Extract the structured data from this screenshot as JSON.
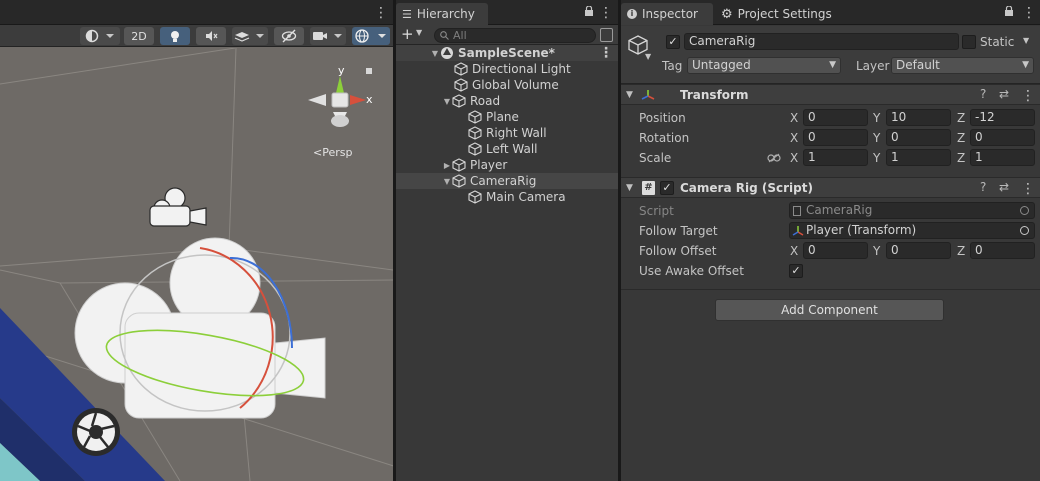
{
  "scene": {
    "toolbar": {
      "mode_2d": "2D"
    },
    "gizmo": {
      "x_label": "x",
      "y_label": "y",
      "projection": "Persp"
    }
  },
  "hierarchy": {
    "tab_label": "Hierarchy",
    "add_label": "+",
    "search_placeholder": "All",
    "scene_name": "SampleScene*",
    "items": [
      {
        "label": "Directional Light"
      },
      {
        "label": "Global Volume"
      },
      {
        "label": "Road"
      },
      {
        "label": "Plane"
      },
      {
        "label": "Right Wall"
      },
      {
        "label": "Left Wall"
      },
      {
        "label": "Player"
      },
      {
        "label": "CameraRig"
      },
      {
        "label": "Main Camera"
      }
    ]
  },
  "inspector": {
    "tabs": [
      {
        "label": "Inspector"
      },
      {
        "label": "Project Settings"
      }
    ],
    "object": {
      "name": "CameraRig",
      "static_label": "Static",
      "tag_label": "Tag",
      "tag_value": "Untagged",
      "layer_label": "Layer",
      "layer_value": "Default"
    },
    "transform": {
      "title": "Transform",
      "position": {
        "label": "Position",
        "x": "0",
        "y": "10",
        "z": "-12"
      },
      "rotation": {
        "label": "Rotation",
        "x": "0",
        "y": "0",
        "z": "0"
      },
      "scale": {
        "label": "Scale",
        "x": "1",
        "y": "1",
        "z": "1"
      }
    },
    "camera_rig": {
      "title": "Camera Rig (Script)",
      "script_label": "Script",
      "script_value": "CameraRig",
      "follow_target_label": "Follow Target",
      "follow_target_value": "Player (Transform)",
      "follow_offset_label": "Follow Offset",
      "follow_offset": {
        "x": "0",
        "y": "0",
        "z": "0"
      },
      "use_awake_offset_label": "Use Awake Offset",
      "use_awake_offset_checked": "✓"
    },
    "add_component_label": "Add Component"
  },
  "axis_letters": {
    "x": "X",
    "y": "Y",
    "z": "Z"
  },
  "colors": {
    "accent": "#46607c",
    "selection": "#464646",
    "x_axis": "#d6503c",
    "y_axis": "#8ccf3a",
    "z_axis": "#3c6fd6"
  }
}
